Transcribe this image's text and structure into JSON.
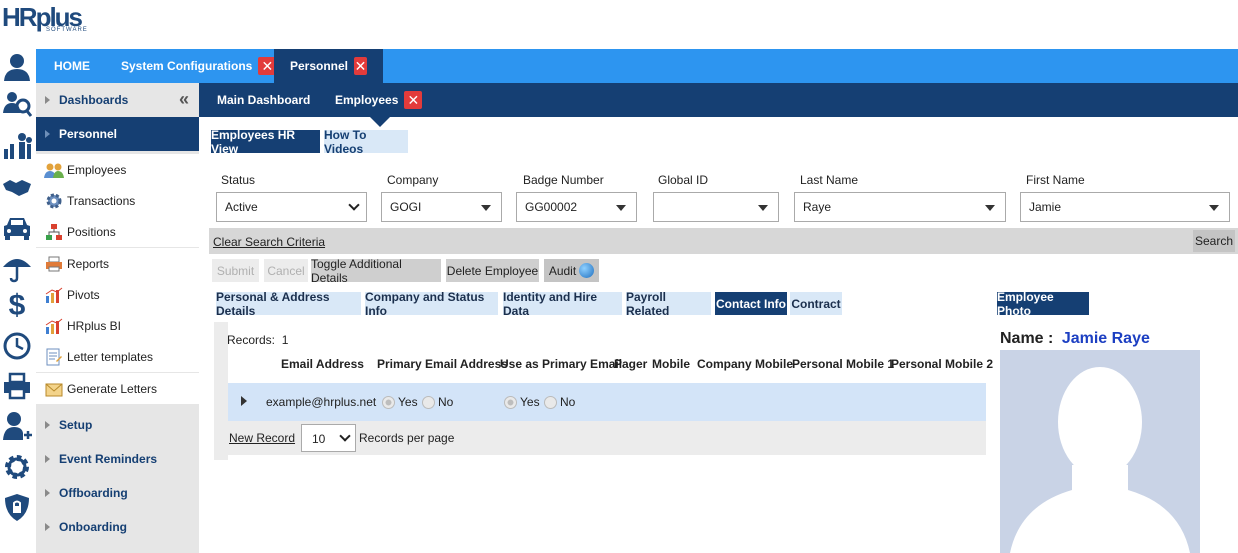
{
  "logo": {
    "hr": "HR",
    "plus": "plus",
    "sub": "SOFTWARE"
  },
  "top_tabs": [
    {
      "label": "HOME"
    },
    {
      "label": "System Configurations"
    },
    {
      "label": "Personnel"
    }
  ],
  "sub_tabs": [
    {
      "label": "Main Dashboard"
    },
    {
      "label": "Employees"
    }
  ],
  "sidebar": {
    "sections": [
      {
        "label": "Dashboards"
      },
      {
        "label": "Personnel"
      },
      {
        "label": "Setup"
      },
      {
        "label": "Event Reminders"
      },
      {
        "label": "Offboarding"
      },
      {
        "label": "Onboarding"
      }
    ],
    "personnel_items": [
      {
        "label": "Employees"
      },
      {
        "label": "Transactions"
      },
      {
        "label": "Positions"
      },
      {
        "label": "Reports"
      },
      {
        "label": "Pivots"
      },
      {
        "label": "HRplus BI"
      },
      {
        "label": "Letter templates"
      },
      {
        "label": "Generate Letters"
      }
    ]
  },
  "view_buttons": {
    "hr_view": "Employees HR View",
    "videos": "How To Videos"
  },
  "filters": [
    {
      "label": "Status",
      "value": "Active"
    },
    {
      "label": "Company",
      "value": "GOGI"
    },
    {
      "label": "Badge Number",
      "value": "GG00002"
    },
    {
      "label": "Global ID",
      "value": ""
    },
    {
      "label": "Last Name",
      "value": "Raye"
    },
    {
      "label": "First Name",
      "value": "Jamie"
    }
  ],
  "search": {
    "clear": "Clear Search Criteria",
    "button": "Search"
  },
  "actions": {
    "submit": "Submit",
    "cancel": "Cancel",
    "toggle": "Toggle Additional Details",
    "delete": "Delete Employee",
    "audit": "Audit"
  },
  "detail_tabs": [
    {
      "label": "Personal & Address Details"
    },
    {
      "label": "Company and Status Info"
    },
    {
      "label": "Identity and Hire Data"
    },
    {
      "label": "Payroll Related"
    },
    {
      "label": "Contact Info"
    },
    {
      "label": "Contract"
    }
  ],
  "photo_tab": "Employee Photo",
  "table": {
    "records_label": "Records:",
    "records_count": "1",
    "headers": [
      "Email Address",
      "Primary Email Address",
      "Use as Primary Email",
      "Pager",
      "Mobile",
      "Company Mobile",
      "Personal Mobile 1",
      "Personal Mobile 2"
    ],
    "row": {
      "email": "example@hrplus.net",
      "primary_yes": "Yes",
      "primary_no": "No",
      "use_yes": "Yes",
      "use_no": "No"
    },
    "new_record": "New Record",
    "page_size": "10",
    "per_page_label": "Records per page"
  },
  "employee": {
    "name_label": "Name :",
    "name": "Jamie Raye"
  },
  "colors": {
    "accent": "#2d95f0",
    "dark": "#153f73",
    "close": "#e23b3b"
  }
}
